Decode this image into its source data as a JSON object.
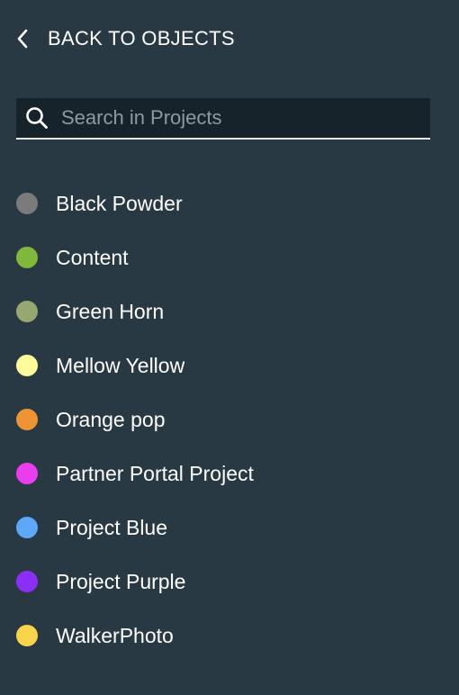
{
  "nav": {
    "back_label": "BACK TO OBJECTS",
    "back_icon": "chevron-left-icon"
  },
  "search": {
    "placeholder": "Search in Projects",
    "value": "",
    "icon": "search-icon"
  },
  "projects": [
    {
      "label": "Black Powder",
      "color": "#7b7b7b"
    },
    {
      "label": "Content",
      "color": "#80b83b"
    },
    {
      "label": "Green Horn",
      "color": "#96a870"
    },
    {
      "label": "Mellow Yellow",
      "color": "#fffb9b"
    },
    {
      "label": "Orange pop",
      "color": "#ef9434"
    },
    {
      "label": "Partner Portal Project",
      "color": "#ea3eee"
    },
    {
      "label": "Project Blue",
      "color": "#5ea8f9"
    },
    {
      "label": "Project Purple",
      "color": "#8b2ef6"
    },
    {
      "label": "WalkerPhoto",
      "color": "#f8d44a"
    }
  ]
}
